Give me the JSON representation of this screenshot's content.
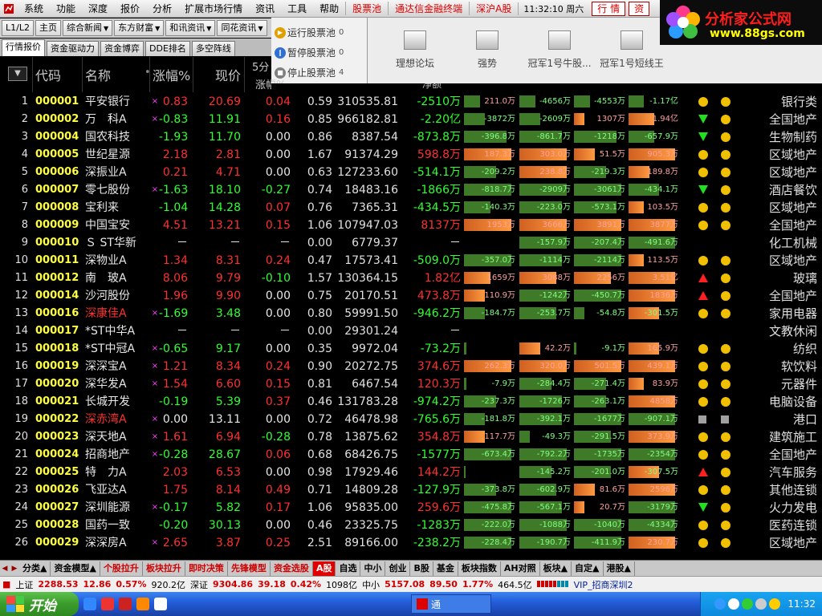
{
  "menu": {
    "items": [
      "系统",
      "功能",
      "深度",
      "报价",
      "分析",
      "扩展市场行情",
      "资讯",
      "工具",
      "帮助"
    ],
    "special": [
      "股票池",
      "通达信金融终端",
      "深沪A股"
    ],
    "clock": "11:32:10 周六",
    "btn_hq": "行 情",
    "btn_zi": "资"
  },
  "logo": {
    "line1": "分析家公式网",
    "line2": "www.88gs.com"
  },
  "nav": {
    "level": "L1/L2",
    "home": "主页",
    "news": "综合新闻",
    "dfcf": "东方财富",
    "hexun": "和讯资讯",
    "ths": "同花资讯"
  },
  "tabs": [
    "行情报价",
    "资金驱动力",
    "资金博弈",
    "DDE排名",
    "多空阵线"
  ],
  "pool": [
    {
      "label": "运行股票池",
      "count": "0"
    },
    {
      "label": "暂停股票池",
      "count": "0"
    },
    {
      "label": "停止股票池",
      "count": "4"
    }
  ],
  "strategies": [
    "理想论坛",
    "强势",
    "冠军1号牛股...",
    "冠军1号短线王"
  ],
  "headers": {
    "code": "代码",
    "name": "名称",
    "chg": "涨幅%",
    "price": "现价",
    "m5a": "5分",
    "m5b": "涨幅%",
    "net": "净额"
  },
  "rows": [
    {
      "i": "1",
      "code": "000001",
      "name": "平安银行",
      "nc": "wht",
      "mark": "×",
      "chg": "0.83",
      "price": "20.69",
      "m5": "0.04",
      "turn": "0.59",
      "vol": "310535.81",
      "net": "-2510万",
      "b1": {
        "v": -0.3,
        "t": "211.0万"
      },
      "b2": {
        "v": -0.3,
        "t": "-4656万"
      },
      "b3": {
        "v": -0.3,
        "t": "-4553万"
      },
      "b4": {
        "v": -0.3,
        "t": "-1.17亿"
      },
      "s1": "dot",
      "s2": "dot",
      "ind": "银行类"
    },
    {
      "i": "2",
      "code": "000002",
      "name": "万　科A",
      "nc": "wht",
      "mark": "×",
      "chg": "-0.83",
      "price": "11.91",
      "m5": "0.16",
      "turn": "0.85",
      "vol": "966182.81",
      "net": "-2.20亿",
      "b1": {
        "v": -0.4,
        "t": "-3872万"
      },
      "b2": {
        "v": -0.4,
        "t": "-2609万"
      },
      "b3": {
        "v": 0.2,
        "t": "1307万"
      },
      "b4": {
        "v": 0.5,
        "t": "1.94亿"
      },
      "s1": "tri-dn",
      "s2": "dot",
      "ind": "全国地产"
    },
    {
      "i": "3",
      "code": "000004",
      "name": "国农科技",
      "nc": "wht",
      "mark": "",
      "chg": "-1.93",
      "price": "11.70",
      "m5": "0.00",
      "turn": "0.86",
      "vol": "8387.54",
      "net": "-873.8万",
      "b1": {
        "v": -0.8,
        "t": "-396.8万"
      },
      "b2": {
        "v": -0.8,
        "t": "-861.7万"
      },
      "b3": {
        "v": -0.8,
        "t": "-1218万"
      },
      "b4": {
        "v": -0.5,
        "t": "-657.9万"
      },
      "s1": "tri-dn",
      "s2": "dot",
      "ind": "生物制药"
    },
    {
      "i": "4",
      "code": "000005",
      "name": "世纪星源",
      "nc": "wht",
      "mark": "",
      "chg": "2.18",
      "price": "2.81",
      "m5": "0.00",
      "turn": "1.67",
      "vol": "91374.29",
      "net": "598.8万",
      "b1": {
        "v": 0.9,
        "t": "187.3万"
      },
      "b2": {
        "v": 0.9,
        "t": "303.0万"
      },
      "b3": {
        "v": 0.4,
        "t": "51.5万"
      },
      "b4": {
        "v": 0.9,
        "t": "905.3万"
      },
      "s1": "dot",
      "s2": "dot",
      "ind": "区域地产"
    },
    {
      "i": "5",
      "code": "000006",
      "name": "深振业A",
      "nc": "wht",
      "mark": "",
      "chg": "0.21",
      "price": "4.71",
      "m5": "0.00",
      "turn": "0.63",
      "vol": "127233.60",
      "net": "-514.1万",
      "b1": {
        "v": -0.6,
        "t": "-209.2万"
      },
      "b2": {
        "v": 0.9,
        "t": "238.8万"
      },
      "b3": {
        "v": -0.6,
        "t": "-219.3万"
      },
      "b4": {
        "v": 0.4,
        "t": "189.8万"
      },
      "s1": "dot",
      "s2": "dot",
      "ind": "区域地产"
    },
    {
      "i": "6",
      "code": "000007",
      "name": "零七股份",
      "nc": "wht",
      "mark": "×",
      "chg": "-1.63",
      "price": "18.10",
      "m5": "-0.27",
      "turn": "0.74",
      "vol": "18483.16",
      "net": "-1866万",
      "b1": {
        "v": -0.9,
        "t": "-818.7万"
      },
      "b2": {
        "v": -0.9,
        "t": "-2909万"
      },
      "b3": {
        "v": -0.9,
        "t": "-3061万"
      },
      "b4": {
        "v": -0.6,
        "t": "-434.1万"
      },
      "s1": "tri-dn",
      "s2": "dot",
      "ind": "酒店餐饮"
    },
    {
      "i": "7",
      "code": "000008",
      "name": "宝利来",
      "nc": "wht",
      "mark": "",
      "chg": "-1.04",
      "price": "14.28",
      "m5": "0.07",
      "turn": "0.76",
      "vol": "7365.31",
      "net": "-434.5万",
      "b1": {
        "v": -0.5,
        "t": "-140.3万"
      },
      "b2": {
        "v": -0.8,
        "t": "-223.0万"
      },
      "b3": {
        "v": -0.8,
        "t": "-573.1万"
      },
      "b4": {
        "v": 0.3,
        "t": "103.5万"
      },
      "s1": "dot",
      "s2": "dot",
      "ind": "区域地产"
    },
    {
      "i": "8",
      "code": "000009",
      "name": "中国宝安",
      "nc": "wht",
      "mark": "",
      "chg": "4.51",
      "price": "13.21",
      "m5": "0.15",
      "turn": "1.06",
      "vol": "107947.03",
      "net": "8137万",
      "b1": {
        "v": 0.9,
        "t": "1953万"
      },
      "b2": {
        "v": 0.9,
        "t": "3666万"
      },
      "b3": {
        "v": 0.9,
        "t": "3891万"
      },
      "b4": {
        "v": 0.9,
        "t": "3877万"
      },
      "s1": "dot",
      "s2": "dot",
      "ind": "全国地产"
    },
    {
      "i": "9",
      "code": "000010",
      "name": "Ｓ ST华新",
      "nc": "wht",
      "mark": "",
      "chg": "－",
      "price": "－",
      "m5": "－",
      "turn": "0.00",
      "vol": "6779.37",
      "net": "－",
      "b1": {
        "v": 0,
        "t": ""
      },
      "b2": {
        "v": -0.9,
        "t": "-157.9万"
      },
      "b3": {
        "v": -0.9,
        "t": "-207.4万"
      },
      "b4": {
        "v": -0.9,
        "t": "-491.6万"
      },
      "s1": "",
      "s2": "",
      "ind": "化工机械"
    },
    {
      "i": "10",
      "code": "000011",
      "name": "深物业A",
      "nc": "wht",
      "mark": "",
      "chg": "1.34",
      "price": "8.31",
      "m5": "0.24",
      "turn": "0.47",
      "vol": "17573.41",
      "net": "-509.0万",
      "b1": {
        "v": -0.9,
        "t": "-357.0万"
      },
      "b2": {
        "v": -0.8,
        "t": "-1114万"
      },
      "b3": {
        "v": -0.9,
        "t": "-2114万"
      },
      "b4": {
        "v": 0.3,
        "t": "113.5万"
      },
      "s1": "dot",
      "s2": "dot",
      "ind": "区域地产"
    },
    {
      "i": "11",
      "code": "000012",
      "name": "南　玻A",
      "nc": "wht",
      "mark": "",
      "chg": "8.06",
      "price": "9.79",
      "m5": "-0.10",
      "turn": "1.57",
      "vol": "130364.15",
      "net": "1.82亿",
      "b1": {
        "v": 0.5,
        "t": "1659万"
      },
      "b2": {
        "v": 0.7,
        "t": "3088万"
      },
      "b3": {
        "v": 0.7,
        "t": "2256万"
      },
      "b4": {
        "v": 0.9,
        "t": "3.51亿"
      },
      "s1": "tri-up",
      "s2": "dot",
      "ind": "玻璃"
    },
    {
      "i": "12",
      "code": "000014",
      "name": "沙河股份",
      "nc": "wht",
      "mark": "",
      "chg": "1.96",
      "price": "9.90",
      "m5": "0.00",
      "turn": "0.75",
      "vol": "20170.51",
      "net": "473.8万",
      "b1": {
        "v": 0.4,
        "t": "110.9万"
      },
      "b2": {
        "v": -0.9,
        "t": "-1242万"
      },
      "b3": {
        "v": -0.9,
        "t": "-450.7万"
      },
      "b4": {
        "v": 0.9,
        "t": "1836万"
      },
      "s1": "tri-up",
      "s2": "dot",
      "ind": "全国地产"
    },
    {
      "i": "13",
      "code": "000016",
      "name": "深康佳A",
      "nc": "red",
      "mark": "×",
      "chg": "-1.69",
      "price": "3.48",
      "m5": "0.00",
      "turn": "0.80",
      "vol": "59991.50",
      "net": "-946.2万",
      "b1": {
        "v": -0.4,
        "t": "-184.7万"
      },
      "b2": {
        "v": -0.7,
        "t": "-253.7万"
      },
      "b3": {
        "v": -0.2,
        "t": "-54.8万"
      },
      "b4": {
        "v": 0.6,
        "t": "-301.5万"
      },
      "s1": "dot",
      "s2": "dot",
      "ind": "家用电器"
    },
    {
      "i": "14",
      "code": "000017",
      "name": "*ST中华A",
      "nc": "wht",
      "mark": "",
      "chg": "－",
      "price": "－",
      "m5": "－",
      "turn": "0.00",
      "vol": "29301.24",
      "net": "－",
      "b1": {
        "v": 0,
        "t": ""
      },
      "b2": {
        "v": 0,
        "t": ""
      },
      "b3": {
        "v": 0,
        "t": ""
      },
      "b4": {
        "v": 0,
        "t": ""
      },
      "s1": "",
      "s2": "",
      "ind": "文教休闲"
    },
    {
      "i": "15",
      "code": "000018",
      "name": "*ST中冠A",
      "nc": "wht",
      "mark": "×",
      "chg": "-0.65",
      "price": "9.17",
      "m5": "0.00",
      "turn": "0.35",
      "vol": "9972.04",
      "net": "-73.2万",
      "b1": {
        "v": -0.05,
        "t": ""
      },
      "b2": {
        "v": 0.4,
        "t": "42.2万"
      },
      "b3": {
        "v": -0.05,
        "t": "-9.1万"
      },
      "b4": {
        "v": 0.6,
        "t": "165.9万"
      },
      "s1": "dot",
      "s2": "dot",
      "ind": "纺织"
    },
    {
      "i": "16",
      "code": "000019",
      "name": "深深宝A",
      "nc": "wht",
      "mark": "×",
      "chg": "1.21",
      "price": "8.34",
      "m5": "0.24",
      "turn": "0.90",
      "vol": "20272.75",
      "net": "374.6万",
      "b1": {
        "v": 0.9,
        "t": "262.3万"
      },
      "b2": {
        "v": 0.9,
        "t": "320.0万"
      },
      "b3": {
        "v": 0.9,
        "t": "501.5万"
      },
      "b4": {
        "v": 0.9,
        "t": "439.1万"
      },
      "s1": "dot",
      "s2": "dot",
      "ind": "软饮料"
    },
    {
      "i": "17",
      "code": "000020",
      "name": "深华发A",
      "nc": "wht",
      "mark": "×",
      "chg": "1.54",
      "price": "6.60",
      "m5": "0.15",
      "turn": "0.81",
      "vol": "6467.54",
      "net": "120.3万",
      "b1": {
        "v": -0.05,
        "t": "-7.9万"
      },
      "b2": {
        "v": -0.6,
        "t": "-284.4万"
      },
      "b3": {
        "v": -0.6,
        "t": "-271.4万"
      },
      "b4": {
        "v": 0.3,
        "t": "83.9万"
      },
      "s1": "dot",
      "s2": "dot",
      "ind": "元器件"
    },
    {
      "i": "18",
      "code": "000021",
      "name": "长城开发",
      "nc": "wht",
      "mark": "",
      "chg": "-0.19",
      "price": "5.39",
      "m5": "0.37",
      "turn": "0.46",
      "vol": "131783.28",
      "net": "-974.2万",
      "b1": {
        "v": -0.6,
        "t": "-237.3万"
      },
      "b2": {
        "v": -0.8,
        "t": "-1726万"
      },
      "b3": {
        "v": -0.6,
        "t": "-263.1万"
      },
      "b4": {
        "v": 0.9,
        "t": "4858万"
      },
      "s1": "dot",
      "s2": "dot",
      "ind": "电脑设备"
    },
    {
      "i": "19",
      "code": "000022",
      "name": "深赤湾A",
      "nc": "red",
      "mark": "×",
      "chg": "0.00",
      "price": "13.11",
      "m5": "0.00",
      "turn": "0.72",
      "vol": "46478.98",
      "net": "-765.6万",
      "b1": {
        "v": -0.4,
        "t": "-181.8万"
      },
      "b2": {
        "v": -0.8,
        "t": "-392.1万"
      },
      "b3": {
        "v": -0.9,
        "t": "-1677万"
      },
      "b4": {
        "v": -0.9,
        "t": "-907.1万"
      },
      "s1": "sq",
      "s2": "sq",
      "ind": "港口"
    },
    {
      "i": "20",
      "code": "000023",
      "name": "深天地A",
      "nc": "wht",
      "mark": "×",
      "chg": "1.61",
      "price": "6.94",
      "m5": "-0.28",
      "turn": "0.78",
      "vol": "13875.62",
      "net": "354.8万",
      "b1": {
        "v": 0.4,
        "t": "117.7万"
      },
      "b2": {
        "v": -0.2,
        "t": "-49.3万"
      },
      "b3": {
        "v": -0.7,
        "t": "-291.5万"
      },
      "b4": {
        "v": 0.9,
        "t": "373.9万"
      },
      "s1": "dot",
      "s2": "dot",
      "ind": "建筑施工"
    },
    {
      "i": "21",
      "code": "000024",
      "name": "招商地产",
      "nc": "wht",
      "mark": "×",
      "chg": "-0.28",
      "price": "28.67",
      "m5": "0.06",
      "turn": "0.68",
      "vol": "68426.75",
      "net": "-1577万",
      "b1": {
        "v": -0.9,
        "t": "-673.4万"
      },
      "b2": {
        "v": -0.9,
        "t": "-792.2万"
      },
      "b3": {
        "v": -0.9,
        "t": "-1735万"
      },
      "b4": {
        "v": -0.9,
        "t": "-2354万"
      },
      "s1": "dot",
      "s2": "dot",
      "ind": "全国地产"
    },
    {
      "i": "22",
      "code": "000025",
      "name": "特　力A",
      "nc": "wht",
      "mark": "",
      "chg": "2.03",
      "price": "6.53",
      "m5": "0.00",
      "turn": "0.98",
      "vol": "17929.46",
      "net": "144.2万",
      "b1": {
        "v": -0.02,
        "t": ""
      },
      "b2": {
        "v": -0.6,
        "t": "-145.2万"
      },
      "b3": {
        "v": -0.7,
        "t": "-201.0万"
      },
      "b4": {
        "v": 0.6,
        "t": "-307.5万"
      },
      "s1": "tri-up",
      "s2": "dot",
      "ind": "汽车服务"
    },
    {
      "i": "23",
      "code": "000026",
      "name": "飞亚达A",
      "nc": "wht",
      "mark": "",
      "chg": "1.75",
      "price": "8.14",
      "m5": "0.49",
      "turn": "0.71",
      "vol": "14809.28",
      "net": "-127.9万",
      "b1": {
        "v": -0.6,
        "t": "-373.8万"
      },
      "b2": {
        "v": -0.7,
        "t": "-602.9万"
      },
      "b3": {
        "v": 0.4,
        "t": "81.6万"
      },
      "b4": {
        "v": 0.9,
        "t": "2596万"
      },
      "s1": "dot",
      "s2": "dot",
      "ind": "其他连锁"
    },
    {
      "i": "24",
      "code": "000027",
      "name": "深圳能源",
      "nc": "wht",
      "mark": "×",
      "chg": "-0.17",
      "price": "5.82",
      "m5": "0.17",
      "turn": "1.06",
      "vol": "95835.00",
      "net": "259.6万",
      "b1": {
        "v": -0.9,
        "t": "-475.8万"
      },
      "b2": {
        "v": -0.8,
        "t": "-567.1万"
      },
      "b3": {
        "v": 0.2,
        "t": "20.7万"
      },
      "b4": {
        "v": -0.9,
        "t": "-3179万"
      },
      "s1": "tri-dn",
      "s2": "dot",
      "ind": "火力发电"
    },
    {
      "i": "25",
      "code": "000028",
      "name": "国药一致",
      "nc": "wht",
      "mark": "",
      "chg": "-0.20",
      "price": "30.13",
      "m5": "0.00",
      "turn": "0.46",
      "vol": "23325.75",
      "net": "-1283万",
      "b1": {
        "v": -0.9,
        "t": "-222.0万"
      },
      "b2": {
        "v": -0.9,
        "t": "-1088万"
      },
      "b3": {
        "v": -0.9,
        "t": "-1040万"
      },
      "b4": {
        "v": -0.9,
        "t": "-4334万"
      },
      "s1": "dot",
      "s2": "dot",
      "ind": "医药连锁"
    },
    {
      "i": "26",
      "code": "000029",
      "name": "深深房A",
      "nc": "wht",
      "mark": "×",
      "chg": "2.65",
      "price": "3.87",
      "m5": "0.25",
      "turn": "2.51",
      "vol": "89166.00",
      "net": "-238.2万",
      "b1": {
        "v": -0.9,
        "t": "-228.4万"
      },
      "b2": {
        "v": -0.9,
        "t": "-190.7万"
      },
      "b3": {
        "v": -0.9,
        "t": "-411.9万"
      },
      "b4": {
        "v": 0.9,
        "t": "230.7万"
      },
      "s1": "dot",
      "s2": "dot",
      "ind": "区域地产"
    }
  ],
  "bottom_tabs": [
    {
      "label": "分类▲",
      "red": false
    },
    {
      "label": "资金模型▲",
      "red": false
    },
    {
      "label": "个股拉升",
      "red": true
    },
    {
      "label": "板块拉升",
      "red": true
    },
    {
      "label": "即时决策",
      "red": true
    },
    {
      "label": "先锋模型",
      "red": true
    },
    {
      "label": "资金选股",
      "red": true
    },
    {
      "label": "A股",
      "red": false,
      "active": true
    },
    {
      "label": "自选",
      "red": false
    },
    {
      "label": "中小",
      "red": false
    },
    {
      "label": "创业",
      "red": false
    },
    {
      "label": "B股",
      "red": false
    },
    {
      "label": "基金",
      "red": false
    },
    {
      "label": "板块指数",
      "red": false
    },
    {
      "label": "AH对照",
      "red": false
    },
    {
      "label": "板块▲",
      "red": false
    },
    {
      "label": "自定▲",
      "red": false
    },
    {
      "label": "港股▲",
      "red": false
    }
  ],
  "status": {
    "sh_name": "上证",
    "sh_val": "2288.53",
    "sh_chg": "12.86",
    "sh_pct": "0.57%",
    "sh_amt": "920.2亿",
    "sz_name": "深证",
    "sz_val": "9304.86",
    "sz_chg": "39.18",
    "sz_pct": "0.42%",
    "sz_amt": "1098亿",
    "zx_name": "中小",
    "zx_val": "5157.08",
    "zx_chg": "89.50",
    "zx_pct": "1.77%",
    "zx_amt": "464.5亿",
    "vip": "VIP_招商深圳2"
  },
  "taskbar": {
    "start": "开始",
    "time": "11:32",
    "task": "通"
  }
}
